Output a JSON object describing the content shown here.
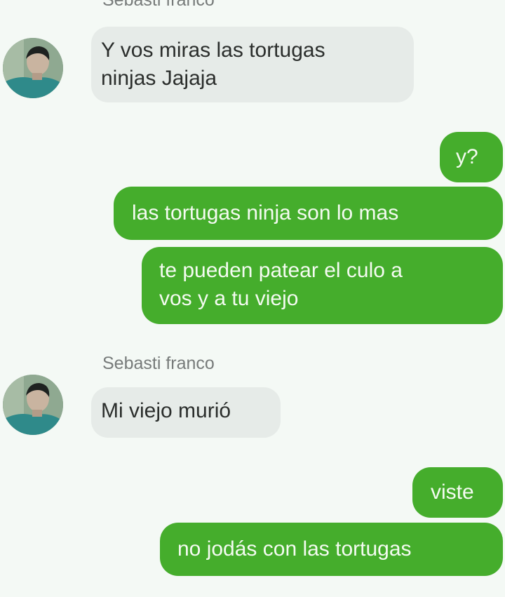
{
  "contact": {
    "name": "Sebasti franco"
  },
  "colors": {
    "background": "#f4f9f5",
    "incoming_bubble": "#e6ebe8",
    "outgoing_bubble": "#45ad2c",
    "sender_name": "#777b7a"
  },
  "messages": [
    {
      "direction": "incoming",
      "sender": "Sebasti franco",
      "lines": [
        "Y vos miras las tortugas",
        "ninjas Jajaja"
      ]
    },
    {
      "direction": "outgoing",
      "lines": [
        "y?"
      ]
    },
    {
      "direction": "outgoing",
      "lines": [
        "las tortugas ninja son lo mas"
      ]
    },
    {
      "direction": "outgoing",
      "lines": [
        "te pueden patear el culo a",
        "vos y a tu viejo"
      ]
    },
    {
      "direction": "incoming",
      "sender": "Sebasti franco",
      "lines": [
        "Mi viejo murió"
      ]
    },
    {
      "direction": "outgoing",
      "lines": [
        "viste"
      ]
    },
    {
      "direction": "outgoing",
      "lines": [
        "no jodás con las tortugas"
      ]
    }
  ]
}
